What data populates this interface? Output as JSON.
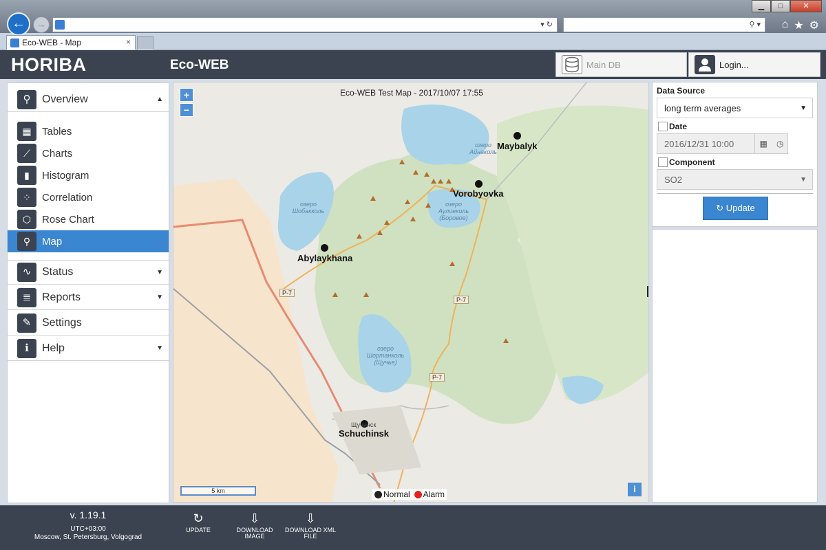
{
  "browser": {
    "tab_title": "Eco-WEB - Map",
    "tab_close": "×",
    "back": "←",
    "forward": "→",
    "addr_controls": "▾ ↻",
    "search_controls": "⚲ ▾",
    "toolbar_icons": [
      "home-icon",
      "star-icon",
      "gear-icon"
    ]
  },
  "header": {
    "brand": "HORIBA",
    "app_title": "Eco-WEB",
    "db_button": "Main DB",
    "login_button": "Login..."
  },
  "sidebar": {
    "overview": {
      "label": "Overview",
      "icon": "search-icon"
    },
    "items": [
      {
        "label": "Tables",
        "icon": "table-icon"
      },
      {
        "label": "Charts",
        "icon": "line-chart-icon"
      },
      {
        "label": "Histogram",
        "icon": "bar-chart-icon"
      },
      {
        "label": "Correlation",
        "icon": "scatter-icon"
      },
      {
        "label": "Rose Chart",
        "icon": "hexagon-icon"
      },
      {
        "label": "Map",
        "icon": "map-marker-icon"
      }
    ],
    "active": "Map",
    "sections": [
      {
        "label": "Status",
        "icon": "pulse-icon"
      },
      {
        "label": "Reports",
        "icon": "report-icon"
      },
      {
        "label": "Settings",
        "icon": "wrench-icon"
      },
      {
        "label": "Help",
        "icon": "info-icon"
      }
    ]
  },
  "map": {
    "title": "Eco-WEB Test Map - 2017/10/07 17:55",
    "zoom_in": "+",
    "zoom_out": "−",
    "scale": "5 km",
    "info": "i",
    "stations": [
      "Maybalyk",
      "Vorobyovka",
      "Abylaykhana",
      "Schuchinsk"
    ],
    "lakes": [
      "озеро Айнаколь",
      "озеро Шобакколь",
      "озеро Аулиеколь (Боровое)",
      "озеро Шортанколь (Щучье)"
    ],
    "roads": [
      "P-7",
      "P-7",
      "P-7"
    ],
    "town": "Щучинск",
    "legend": [
      {
        "label": "Normal",
        "color": "#222222"
      },
      {
        "label": "Alarm",
        "color": "#e52222"
      }
    ]
  },
  "panel": {
    "data_source_label": "Data Source",
    "data_source_value": "long term averages",
    "date_label": "Date",
    "date_value": "2016/12/31 10:00",
    "component_label": "Component",
    "component_value": "SO2",
    "update_button": "Update"
  },
  "footer": {
    "version": "v. 1.19.1",
    "timezone": "UTC+03:00",
    "cities": "Moscow, St. Petersburg, Volgograd",
    "buttons": [
      {
        "label": "UPDATE",
        "icon": "refresh-icon"
      },
      {
        "label": "DOWNLOAD IMAGE",
        "icon": "download-icon"
      },
      {
        "label": "DOWNLOAD XML FILE",
        "icon": "download-icon"
      }
    ]
  }
}
